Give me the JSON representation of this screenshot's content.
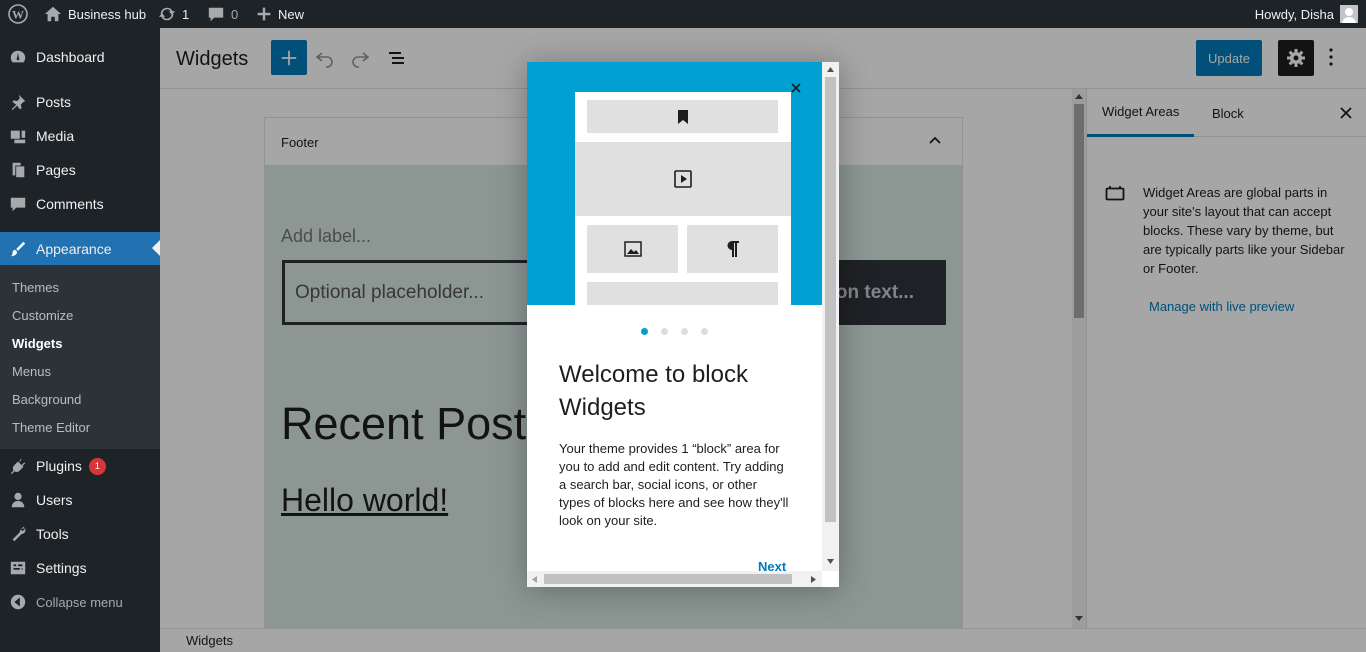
{
  "admin_bar": {
    "site_name": "Business hub",
    "updates_count": "1",
    "comments_count": "0",
    "new_label": "New",
    "greeting": "Howdy, Disha"
  },
  "sidebar": {
    "menu": [
      {
        "label": "Dashboard",
        "icon": "dashboard-icon"
      },
      {
        "label": "Posts",
        "icon": "pin-icon"
      },
      {
        "label": "Media",
        "icon": "media-icon"
      },
      {
        "label": "Pages",
        "icon": "pages-icon"
      },
      {
        "label": "Comments",
        "icon": "comment-icon"
      },
      {
        "label": "Appearance",
        "icon": "brush-icon"
      },
      {
        "label": "Plugins",
        "icon": "plug-icon",
        "badge": "1"
      },
      {
        "label": "Users",
        "icon": "user-icon"
      },
      {
        "label": "Tools",
        "icon": "wrench-icon"
      },
      {
        "label": "Settings",
        "icon": "settings-icon"
      },
      {
        "label": "Collapse menu",
        "icon": "collapse-icon"
      }
    ],
    "appearance_submenu": [
      "Themes",
      "Customize",
      "Widgets",
      "Menus",
      "Background",
      "Theme Editor"
    ]
  },
  "toolbar": {
    "title": "Widgets",
    "update_label": "Update"
  },
  "canvas": {
    "area_title": "Footer",
    "add_label": "Add label...",
    "search_placeholder": "Optional placeholder...",
    "button_text": "Add button text...",
    "recent_posts_heading": "Recent Posts",
    "post_link": "Hello world!"
  },
  "inspector": {
    "tab_widget_areas": "Widget Areas",
    "tab_block": "Block",
    "description": "Widget Areas are global parts in your site's layout that can accept blocks. These vary by theme, but are typically parts like your Sidebar or Footer.",
    "manage_link": "Manage with live preview"
  },
  "modal": {
    "title": "Welcome to block Widgets",
    "body": "Your theme provides 1 “block” area for you to add and edit content. Try adding a search bar, social icons, or other types of blocks here and see how they'll look on your site.",
    "next_label": "Next",
    "current_page": 1,
    "page_count": 4
  },
  "footer": {
    "breadcrumb": "Widgets"
  },
  "colors": {
    "accent": "#007cba",
    "admin_blue": "#2271b1",
    "sidebar_bg": "#1d2327",
    "hero_bg": "#00a0d2",
    "widget_area_bg": "#d7e8e3"
  }
}
